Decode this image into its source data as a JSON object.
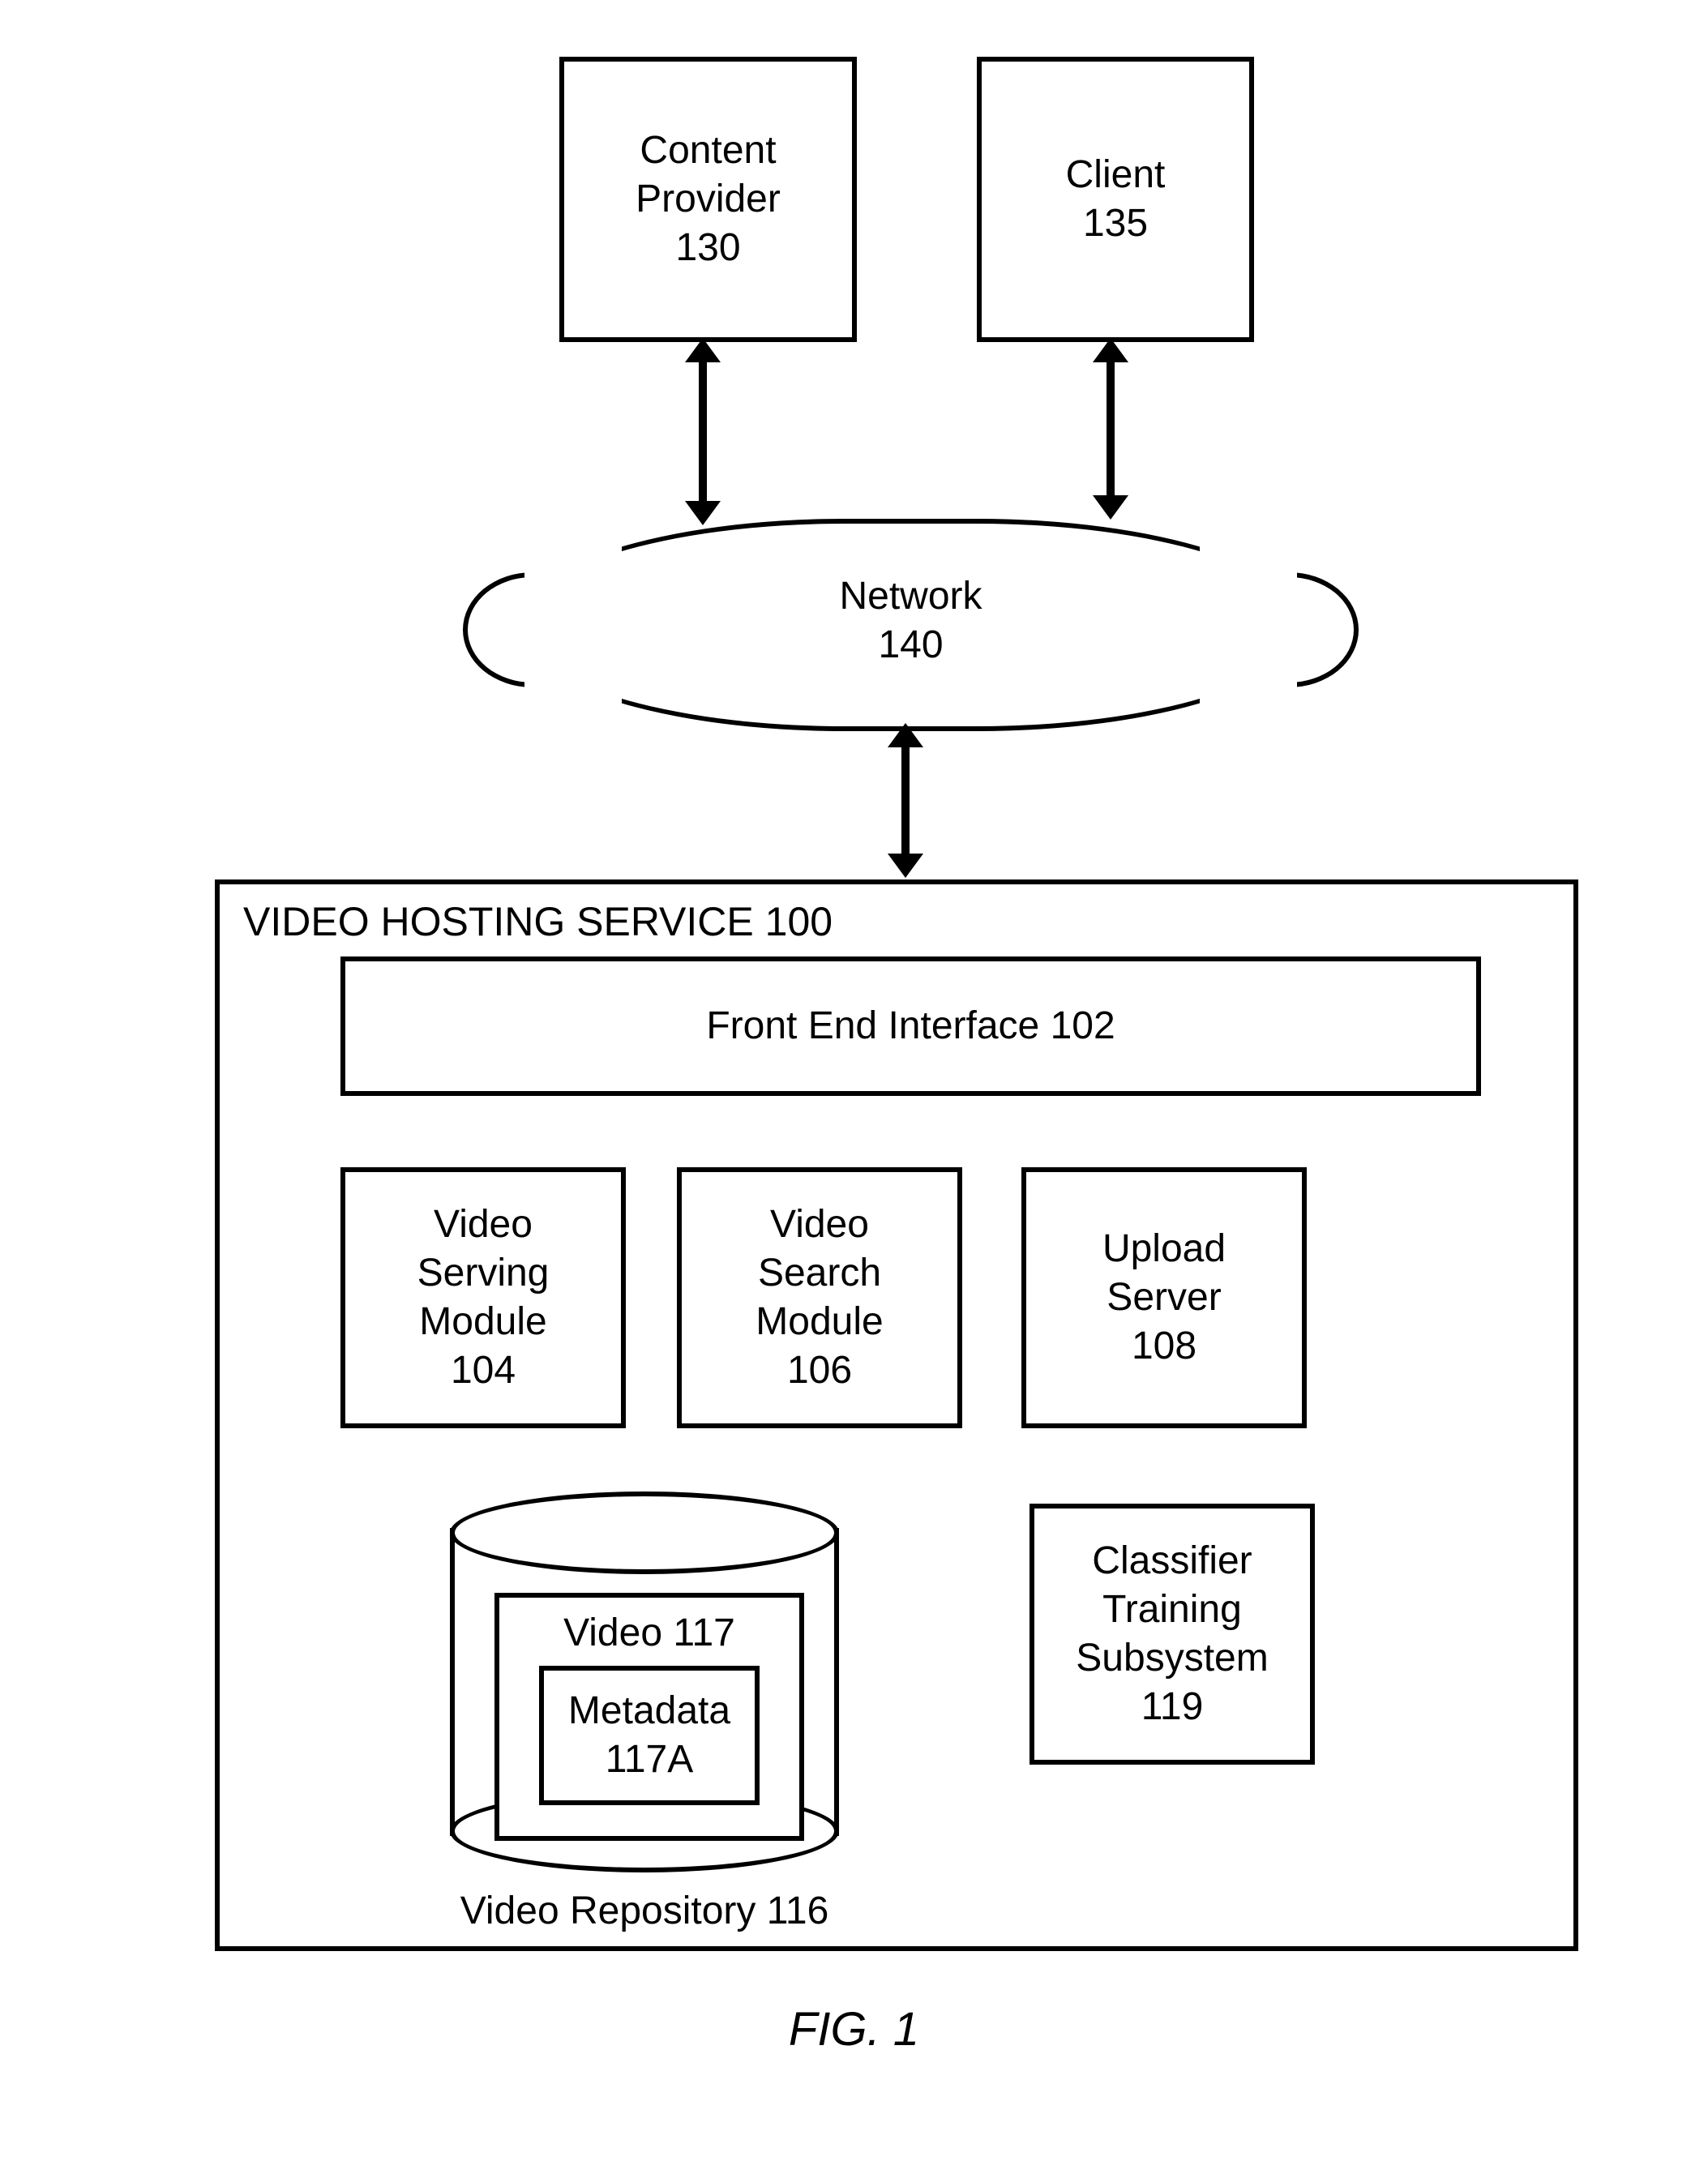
{
  "top": {
    "content_provider": {
      "label": "Content\nProvider",
      "num": "130"
    },
    "client": {
      "label": "Client",
      "num": "135"
    }
  },
  "network": {
    "label": "Network",
    "num": "140"
  },
  "host": {
    "title": "VIDEO HOSTING SERVICE 100",
    "front_end": {
      "label": "Front End Interface 102"
    },
    "serving": {
      "label": "Video\nServing\nModule",
      "num": "104"
    },
    "search": {
      "label": "Video\nSearch\nModule",
      "num": "106"
    },
    "upload": {
      "label": "Upload\nServer",
      "num": "108"
    },
    "classifier": {
      "label": "Classifier\nTraining\nSubsystem",
      "num": "119"
    },
    "repo": {
      "caption": "Video Repository 116",
      "video": {
        "label": "Video 117"
      },
      "metadata": {
        "label": "Metadata",
        "num": "117A"
      }
    }
  },
  "figure": "FIG. 1"
}
